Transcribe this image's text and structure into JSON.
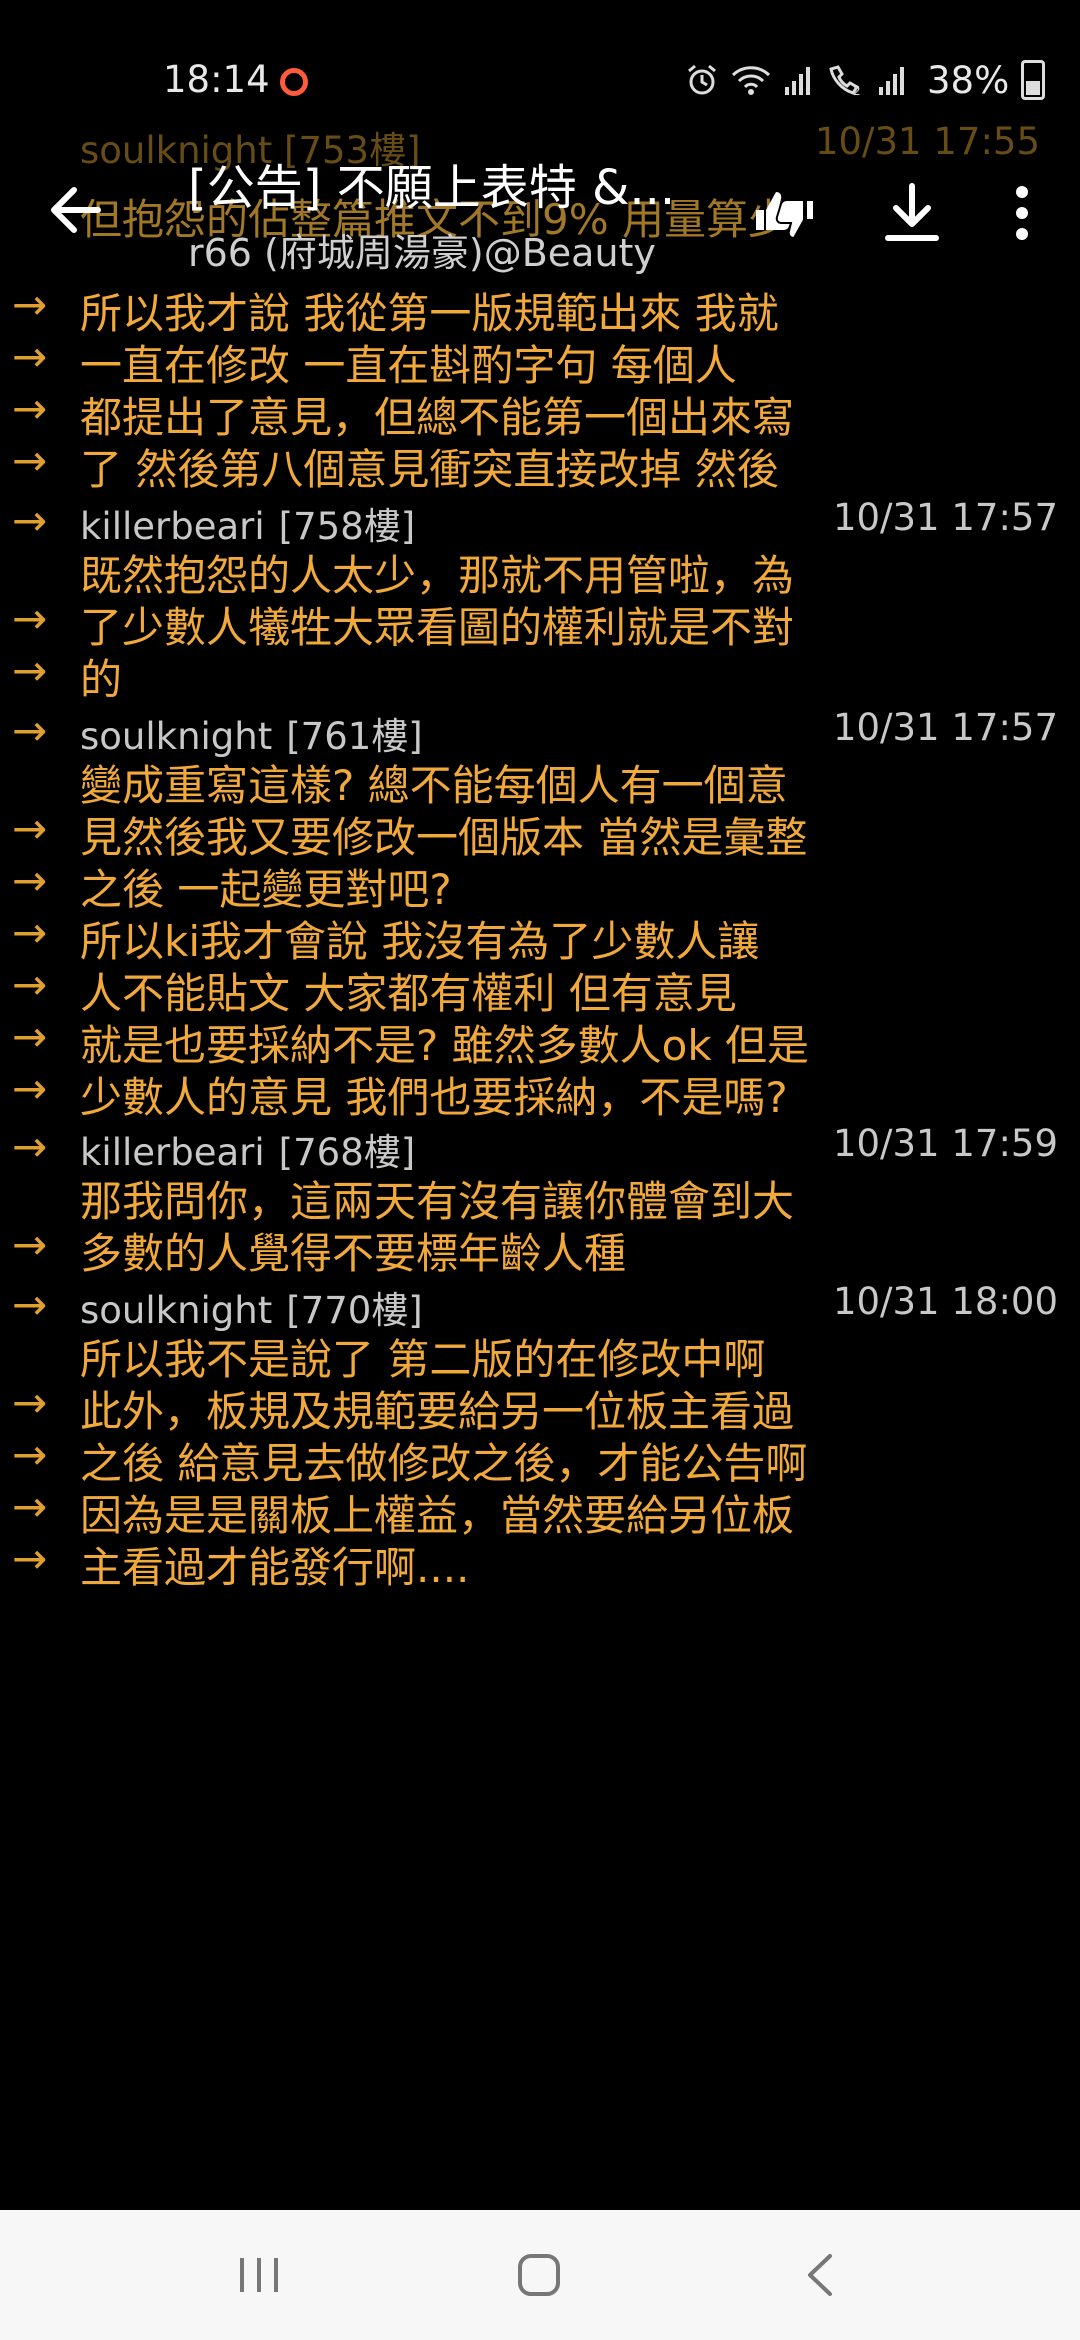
{
  "status": {
    "time": "18:14",
    "battery": "38%",
    "icons": [
      "alarm-icon",
      "wifi-icon",
      "signal-icon",
      "wifi-call-icon",
      "signal-2-icon",
      "battery-icon"
    ]
  },
  "toolbar": {
    "title": "[公告] 不願上表特 &...",
    "subtitle": "r66 (府城周湯豪)@Beauty"
  },
  "ghost": {
    "author": "soulknight",
    "floor": "[753樓]",
    "date": "10/31 17:55",
    "line": "但抱怨的佔整篇推文不到9% 用量算少"
  },
  "comments": [
    {
      "type": "line",
      "arrow": "→",
      "text": "所以我才說  我從第一版規範出來  我就"
    },
    {
      "type": "line",
      "arrow": "→",
      "text": "一直在修改  一直在斟酌字句  每個人"
    },
    {
      "type": "line",
      "arrow": "→",
      "text": "都提出了意見，但總不能第一個出來寫"
    },
    {
      "type": "line",
      "arrow": "→",
      "text": "了  然後第八個意見衝突直接改掉  然後"
    },
    {
      "type": "meta",
      "arrow": "→",
      "author": "killerbeari",
      "floor": "[758樓]",
      "date": "10/31 17:57"
    },
    {
      "type": "line",
      "arrow": "",
      "text": "既然抱怨的人太少，那就不用管啦，為"
    },
    {
      "type": "line",
      "arrow": "→",
      "text": "了少數人犧牲大眾看圖的權利就是不對"
    },
    {
      "type": "line",
      "arrow": "→",
      "text": "的"
    },
    {
      "type": "meta",
      "arrow": "→",
      "author": "soulknight",
      "floor": "[761樓]",
      "date": "10/31 17:57"
    },
    {
      "type": "line",
      "arrow": "",
      "text": "變成重寫這樣?  總不能每個人有一個意"
    },
    {
      "type": "line",
      "arrow": "→",
      "text": "見然後我又要修改一個版本  當然是彙整"
    },
    {
      "type": "line",
      "arrow": "→",
      "text": "之後  一起變更對吧?"
    },
    {
      "type": "line",
      "arrow": "→",
      "text": "所以ki我才會說  我沒有為了少數人讓"
    },
    {
      "type": "line",
      "arrow": "→",
      "text": "人不能貼文  大家都有權利  但有意見"
    },
    {
      "type": "line",
      "arrow": "→",
      "text": "就是也要採納不是?  雖然多數人ok  但是"
    },
    {
      "type": "line",
      "arrow": "→",
      "text": "少數人的意見  我們也要採納，不是嗎?"
    },
    {
      "type": "meta",
      "arrow": "→",
      "author": "killerbeari",
      "floor": "[768樓]",
      "date": "10/31 17:59"
    },
    {
      "type": "line",
      "arrow": "",
      "text": "那我問你，這兩天有沒有讓你體會到大"
    },
    {
      "type": "line",
      "arrow": "→",
      "text": "多數的人覺得不要標年齡人種"
    },
    {
      "type": "meta",
      "arrow": "→",
      "author": "soulknight",
      "floor": "[770樓]",
      "date": "10/31 18:00"
    },
    {
      "type": "line",
      "arrow": "",
      "text": "所以我不是說了  第二版的在修改中啊"
    },
    {
      "type": "line",
      "arrow": "→",
      "text": "此外，板規及規範要給另一位板主看過"
    },
    {
      "type": "line",
      "arrow": "→",
      "text": "之後  給意見去做修改之後，才能公告啊"
    },
    {
      "type": "line",
      "arrow": "→",
      "text": "因為是是關板上權益，當然要給另位板"
    },
    {
      "type": "line",
      "arrow": "→",
      "text": "主看過才能發行啊...."
    }
  ],
  "nav": [
    "recents-icon",
    "home-icon",
    "back-icon"
  ]
}
